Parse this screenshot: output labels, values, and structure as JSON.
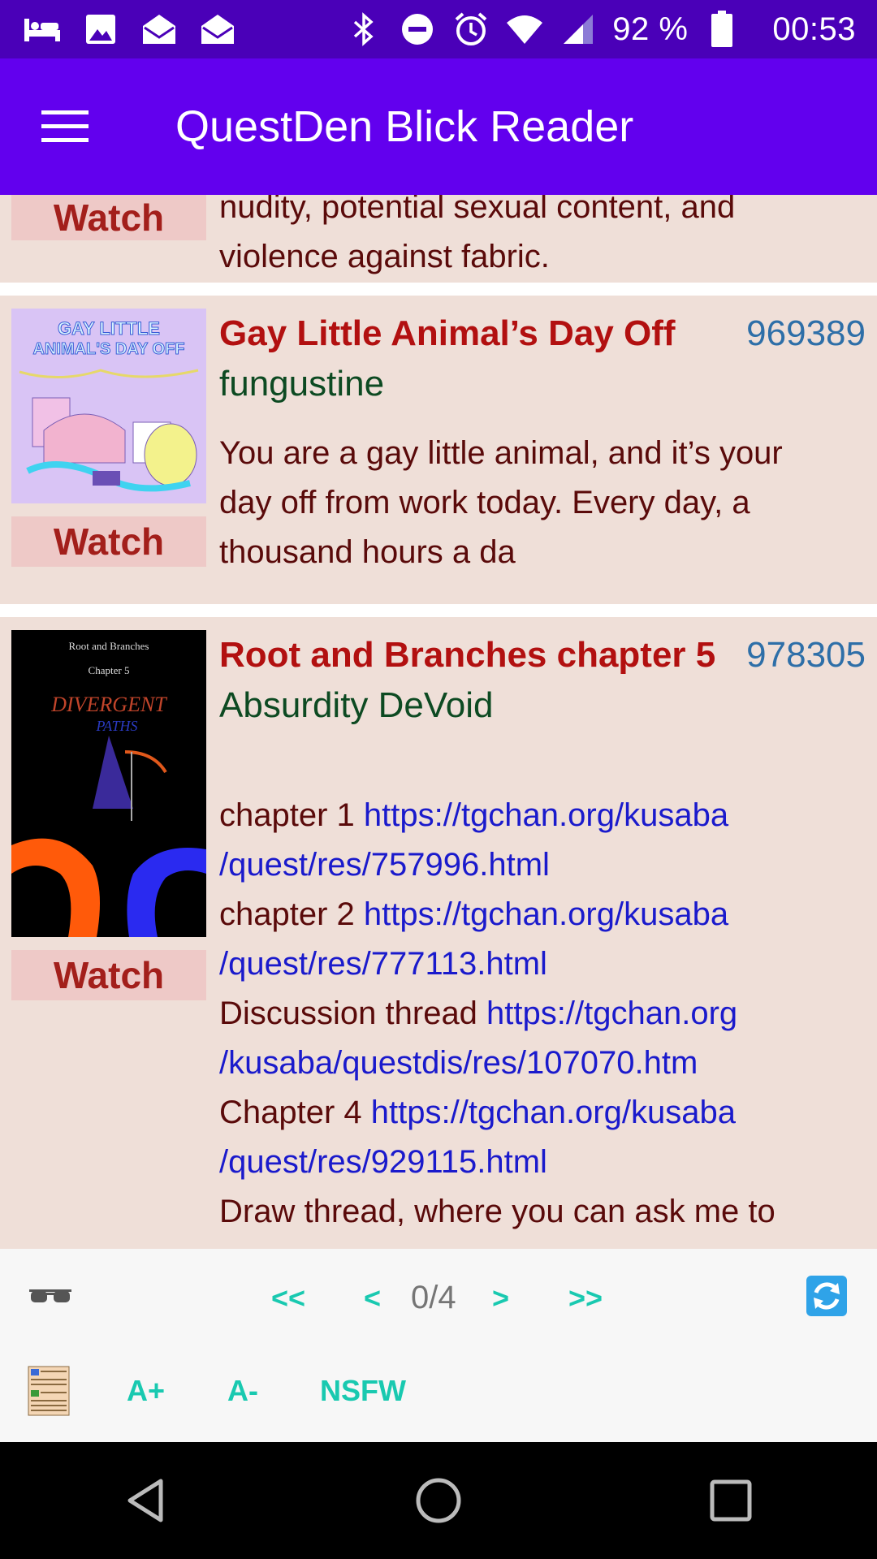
{
  "status_bar": {
    "battery_text": "92 %",
    "time": "00:53",
    "left_icons": [
      "bed-icon",
      "image-icon",
      "mail-open-icon",
      "mail-open-icon"
    ],
    "right_icons": [
      "bluetooth-icon",
      "do-not-disturb-icon",
      "alarm-icon",
      "wifi-icon",
      "signal-icon",
      "battery-icon"
    ]
  },
  "app_bar": {
    "title": "QuestDen Blick Reader",
    "menu_icon": "menu-icon",
    "color": "#6200EE"
  },
  "quests": [
    {
      "watch_label": "Watch",
      "description_lines": [
        "nudity, potential sexual content, and",
        "violence against fabric."
      ]
    },
    {
      "title": "Gay Little Animal’s Day Off",
      "id": "969389",
      "author": "fungustine",
      "watch_label": "Watch",
      "thumbnail_text": [
        "GAY LITTLE",
        "ANIMAL'S DAY OFF"
      ],
      "description_lines": [
        "You are a gay little animal, and it’s your",
        "day off from work today. Every day, a",
        "thousand hours a da"
      ]
    },
    {
      "title": "Root and Branches chapter 5",
      "id": "978305",
      "author": "Absurdity DeVoid",
      "watch_label": "Watch",
      "thumbnail_text": [
        "Root and Branches",
        "Chapter 5",
        "DIVERGENT",
        "PATHS"
      ],
      "description_lines": [
        {
          "text": "chapter 1 ",
          "link": "https://tgchan.org/kusaba"
        },
        {
          "text": "",
          "link": "/quest/res/757996.html"
        },
        {
          "text": "chapter 2 ",
          "link": "https://tgchan.org/kusaba"
        },
        {
          "text": "",
          "link": "/quest/res/777113.html"
        },
        {
          "text": "Discussion thread ",
          "link": "https://tgchan.org"
        },
        {
          "text": "",
          "link": "/kusaba/questdis/res/107070.htm"
        },
        {
          "text": "Chapter 4 ",
          "link": "https://tgchan.org/kusaba"
        },
        {
          "text": "",
          "link": "/quest/res/929115.html"
        },
        {
          "text": "Draw thread, where you can ask me to",
          "link": ""
        }
      ]
    }
  ],
  "toolbar": {
    "reader_icon": "glasses-icon",
    "first_label": "<<",
    "prev_label": "<",
    "page_count": "0/4",
    "next_label": ">",
    "last_label": ">>",
    "refresh_icon": "refresh-icon",
    "list_icon": "list-view-icon",
    "font_increase_label": "A+",
    "font_decrease_label": "A-",
    "nsfw_label": "NSFW"
  },
  "nav_bar": {
    "back_icon": "back-icon",
    "home_icon": "home-icon",
    "recents_icon": "recents-icon"
  }
}
